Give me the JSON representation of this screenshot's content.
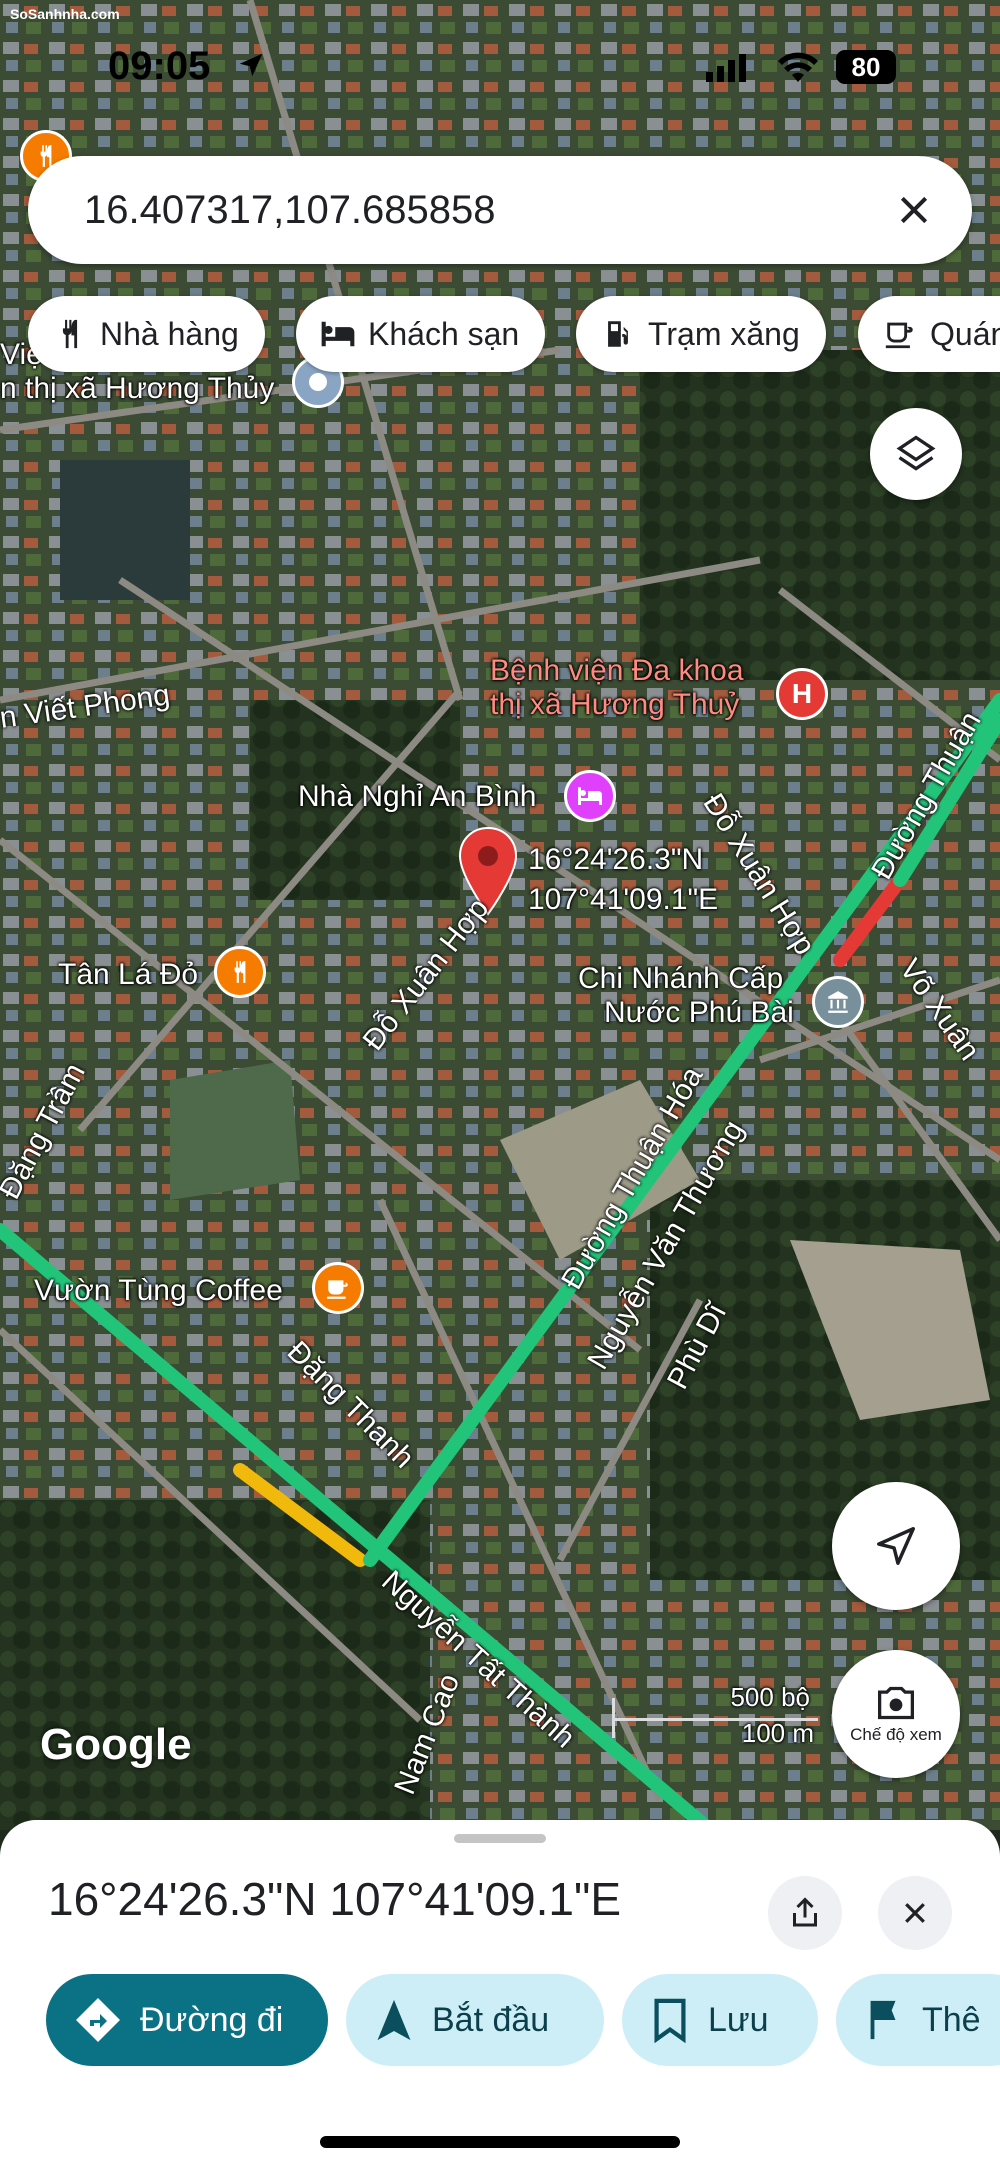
{
  "status_bar": {
    "time": "09:05",
    "battery": "80",
    "watermark": "SoSanhnha.com"
  },
  "search": {
    "query": "16.407317,107.685858"
  },
  "chips": [
    {
      "label": "Nhà hàng",
      "icon": "restaurant-icon"
    },
    {
      "label": "Khách sạn",
      "icon": "hotel-icon"
    },
    {
      "label": "Trạm xăng",
      "icon": "gas-station-icon"
    },
    {
      "label": "Quán",
      "icon": "cafe-icon"
    }
  ],
  "map": {
    "pin_label_lat": "16°24'26.3\"N",
    "pin_label_lng": "107°41'09.1\"E",
    "pois": [
      {
        "name": "Viện ... thị xã Hương Thủy",
        "line1": "Việ",
        "line2": "n thị xã Hương Thủy",
        "type": "place"
      },
      {
        "line1": "Bệnh viện Đa khoa",
        "line2": "thị xã Hương Thuỷ",
        "type": "hospital"
      },
      {
        "line1": "Nhà Nghỉ An Bình",
        "type": "hotel"
      },
      {
        "line1": "Tân Lá Đỏ",
        "type": "restaurant"
      },
      {
        "line1": "Chi Nhánh Cấp",
        "line2": "Nước Phú Bài",
        "type": "government"
      },
      {
        "line1": "Vườn Tùng Coffee",
        "type": "cafe"
      }
    ],
    "streets": [
      "n Viết Phong",
      "Đỗ Xuân Hợp",
      "Đỗ Xuân Hợp",
      "Đường Thuận",
      "Võ Xuân",
      "Đặng Trầm",
      "Đường Thuận Hóa",
      "Nguyễn Văn Thương",
      "Phù Dĩ",
      "Đặng Thanh",
      "Nguyễn Tất Thành",
      "Nam Cao"
    ],
    "scale": {
      "top": "500 bộ",
      "bottom": "100 m"
    },
    "logo": "Google",
    "view_mode_label": "Chế độ xem"
  },
  "sheet": {
    "coordinates": "16°24'26.3\"N 107°41'09.1\"E",
    "actions": [
      {
        "label": "Đường đi",
        "icon": "directions-icon"
      },
      {
        "label": "Bắt đầu",
        "icon": "navigation-arrow-icon"
      },
      {
        "label": "Lưu",
        "icon": "bookmark-icon"
      },
      {
        "label": "Thê",
        "icon": "flag-icon"
      }
    ]
  },
  "colors": {
    "accent": "#0b7285",
    "pin": "#e53935",
    "traffic_green": "#22c47a",
    "traffic_red": "#e53935",
    "traffic_yellow": "#f2b90d"
  }
}
